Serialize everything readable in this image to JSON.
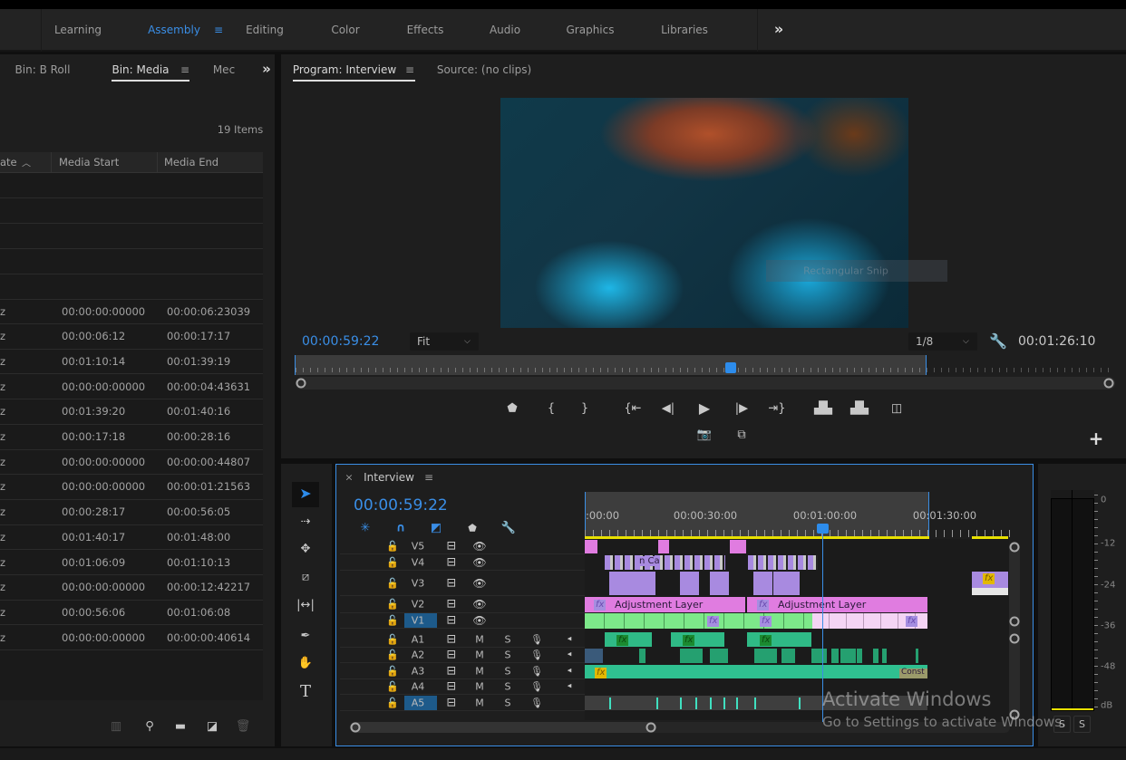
{
  "workspaces": {
    "tabs": [
      "Learning",
      "Assembly",
      "Editing",
      "Color",
      "Effects",
      "Audio",
      "Graphics",
      "Libraries"
    ],
    "active": "Assembly",
    "more": "»",
    "menu": "≡"
  },
  "bin": {
    "tabs": [
      "Bin: B Roll",
      "Bin: Media",
      "Mec"
    ],
    "active": "Bin: Media",
    "more": "»",
    "menu": "≡",
    "item_count": "19 Items",
    "columns": [
      "ate",
      "Media Start",
      "Media End"
    ],
    "sort_indicator": "^",
    "rows": [
      [
        "z",
        "00:00:00:00000",
        "00:00:06:23039"
      ],
      [
        "z",
        "00:00:06:12",
        "00:00:17:17"
      ],
      [
        "z",
        "00:01:10:14",
        "00:01:39:19"
      ],
      [
        "z",
        "00:00:00:00000",
        "00:00:04:43631"
      ],
      [
        "z",
        "00:01:39:20",
        "00:01:40:16"
      ],
      [
        "z",
        "00:00:17:18",
        "00:00:28:16"
      ],
      [
        "z",
        "00:00:00:00000",
        "00:00:00:44807"
      ],
      [
        "z",
        "00:00:00:00000",
        "00:00:01:21563"
      ],
      [
        "z",
        "00:00:28:17",
        "00:00:56:05"
      ],
      [
        "z",
        "00:01:40:17",
        "00:01:48:00"
      ],
      [
        "z",
        "00:01:06:09",
        "00:01:10:13"
      ],
      [
        "z",
        "00:00:00:00000",
        "00:00:12:42217"
      ],
      [
        "z",
        "00:00:56:06",
        "00:01:06:08"
      ],
      [
        "z",
        "00:00:00:00000",
        "00:00:00:40614"
      ]
    ]
  },
  "program": {
    "tabs": [
      "Program: Interview",
      "Source: (no clips)"
    ],
    "active": "Program: Interview",
    "menu": "≡",
    "timecode": "00:00:59:22",
    "zoom": "Fit",
    "resolution": "1/8",
    "duration": "00:01:26:10",
    "overlay_text": "Rectangular Snip",
    "playhead_fraction": 0.69,
    "add": "+"
  },
  "timeline": {
    "close": "×",
    "title": "Interview",
    "menu": "≡",
    "timecode": "00:00:59:22",
    "ruler": [
      ":00:00",
      "00:00:30:00",
      "00:01:00:00",
      "00:01:30:00"
    ],
    "video_tracks": [
      "V5",
      "V4",
      "V3",
      "V2",
      "V1"
    ],
    "audio_tracks": [
      "A1",
      "A2",
      "A3",
      "A4",
      "A5"
    ],
    "mute": "M",
    "solo": "S",
    "clips": {
      "v4_label": "n Ca",
      "v2_a": "Adjustment Layer",
      "v2_b": "Adjustment Layer",
      "a3_label": "Const",
      "fx": "fx"
    }
  },
  "meter": {
    "scale": [
      "0",
      "-12",
      "-24",
      "-36",
      "-48",
      "dB"
    ],
    "solo_buttons": [
      "S",
      "S"
    ]
  },
  "watermark": {
    "title": "Activate Windows",
    "subtitle": "Go to Settings to activate Windows."
  },
  "colors": {
    "accent": "#2d8ceb",
    "adjustment": "#e07ce0",
    "video_clip": "#7de88a",
    "nested": "#a88ae0",
    "audio": "#2fba86",
    "workarea": "#e8e000"
  }
}
